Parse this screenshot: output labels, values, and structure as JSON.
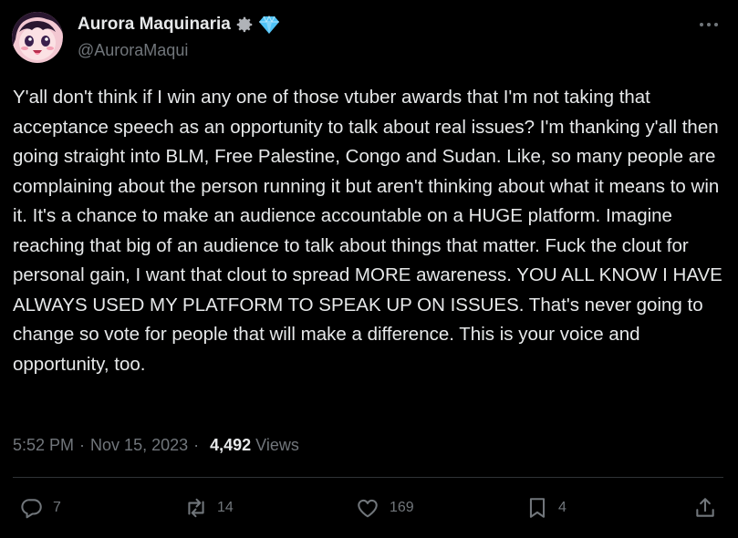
{
  "author": {
    "display_name": "Aurora Maquinaria",
    "handle": "@AuroraMaqui",
    "badges": [
      "gear-icon",
      "diamond-icon"
    ]
  },
  "tweet": {
    "text": "Y'all don't think if I win any one of those vtuber awards that I'm not taking that acceptance speech as an opportunity to talk about real issues? I'm thanking y'all then going straight into BLM, Free Palestine, Congo and Sudan. Like, so many people are complaining about the person running it but aren't thinking about what it means to win it. It's a chance to make an audience accountable on a HUGE platform. Imagine reaching that big of an audience to talk about things that matter. Fuck the clout for personal gain, I want that clout to spread MORE awareness. YOU ALL KNOW I HAVE ALWAYS USED MY PLATFORM TO SPEAK UP ON ISSUES. That's never going to change so vote for people that will make a difference. This is your voice and opportunity, too.",
    "time": "5:52 PM",
    "date": "Nov 15, 2023",
    "separator": "·",
    "views_count": "4,492",
    "views_label": "Views"
  },
  "actions": {
    "replies": "7",
    "reposts": "14",
    "likes": "169",
    "bookmarks": "4"
  },
  "colors": {
    "background": "#000000",
    "text": "#e7e9ea",
    "secondary": "#71767b",
    "divider": "#2f3336",
    "diamond": "#4fc3f7"
  }
}
